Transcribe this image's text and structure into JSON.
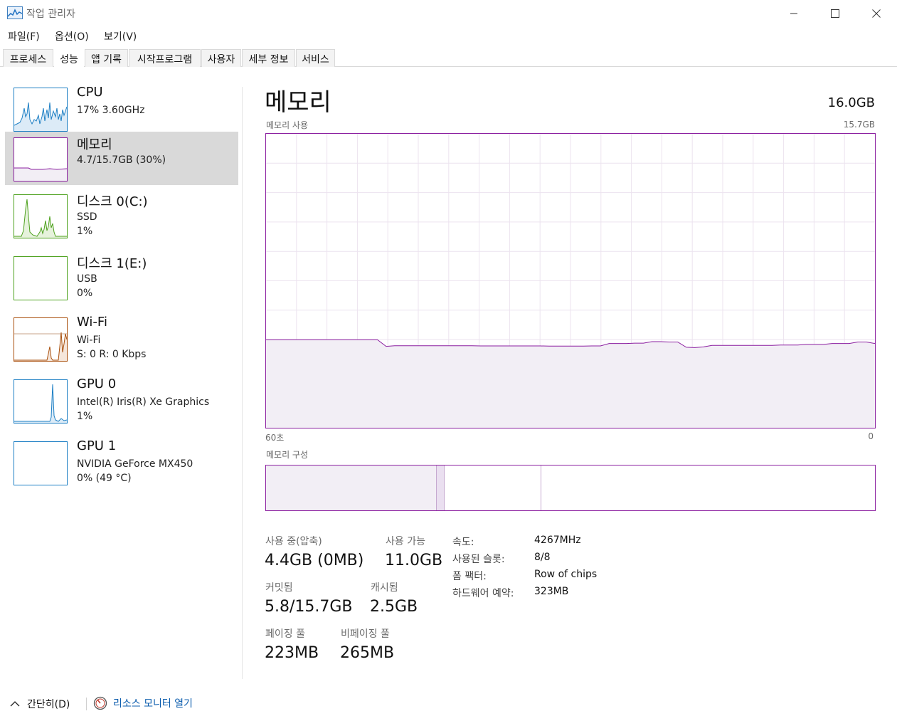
{
  "window": {
    "title": "작업 관리자",
    "icon": "taskmanager-icon"
  },
  "menu": [
    "파일(F)",
    "옵션(O)",
    "보기(V)"
  ],
  "tabs": [
    "프로세스",
    "성능",
    "앱 기록",
    "시작프로그램",
    "사용자",
    "세부 정보",
    "서비스"
  ],
  "active_tab": "성능",
  "sidebar": {
    "items": [
      {
        "name": "CPU",
        "line1": "17%  3.60GHz",
        "line2": "",
        "color": "#1d7fc4"
      },
      {
        "name": "메모리",
        "line1": "4.7/15.7GB (30%)",
        "line2": "",
        "color": "#8b1fa0",
        "selected": true
      },
      {
        "name": "디스크 0(C:)",
        "line1": "SSD",
        "line2": "1%",
        "color": "#4da11d"
      },
      {
        "name": "디스크 1(E:)",
        "line1": "USB",
        "line2": "0%",
        "color": "#4da11d"
      },
      {
        "name": "Wi-Fi",
        "line1": "Wi-Fi",
        "line2": "S: 0  R: 0 Kbps",
        "color": "#a94f0c"
      },
      {
        "name": "GPU 0",
        "line1": "Intel(R) Iris(R) Xe Graphics",
        "line2": "1%",
        "color": "#1d7fc4"
      },
      {
        "name": "GPU 1",
        "line1": "NVIDIA GeForce MX450",
        "line2": "0% (49 °C)",
        "color": "#1d7fc4"
      }
    ]
  },
  "main": {
    "title": "메모리",
    "total": "16.0GB",
    "usage_label": "메모리 사용",
    "usage_max": "15.7GB",
    "axis_left": "60초",
    "axis_right": "0",
    "composition_label": "메모리 구성",
    "accent": "#8b1fa0",
    "stats": {
      "in_use_label": "사용 중(압축)",
      "in_use_value": "4.4GB (0MB)",
      "available_label": "사용 가능",
      "available_value": "11.0GB",
      "committed_label": "커밋됨",
      "committed_value": "5.8/15.7GB",
      "cached_label": "캐시됨",
      "cached_value": "2.5GB",
      "paged_label": "페이징 풀",
      "paged_value": "223MB",
      "nonpaged_label": "비페이징 풀",
      "nonpaged_value": "265MB"
    },
    "details": [
      {
        "label": "속도:",
        "value": "4267MHz"
      },
      {
        "label": "사용된 슬롯:",
        "value": "8/8"
      },
      {
        "label": "폼 팩터:",
        "value": "Row of chips"
      },
      {
        "label": "하드웨어 예약:",
        "value": "323MB"
      }
    ]
  },
  "chart_data": {
    "type": "area",
    "title": "메모리 사용",
    "xlabel": "",
    "ylabel": "",
    "x_range": [
      "60초",
      "0"
    ],
    "ylim": [
      0,
      15.7
    ],
    "grid": true,
    "series": [
      {
        "values": [
          4.7,
          4.7,
          4.7,
          4.7,
          4.7,
          4.7,
          4.7,
          4.7,
          4.7,
          4.7,
          4.7,
          4.7,
          4.7,
          4.7,
          4.35,
          4.38,
          4.38,
          4.38,
          4.38,
          4.38,
          4.38,
          4.38,
          4.38,
          4.38,
          4.38,
          4.37,
          4.37,
          4.37,
          4.37,
          4.37,
          4.37,
          4.37,
          4.37,
          4.36,
          4.36,
          4.36,
          4.36,
          4.36,
          4.37,
          4.37,
          4.5,
          4.5,
          4.5,
          4.52,
          4.52,
          4.6,
          4.6,
          4.58,
          4.58,
          4.3,
          4.28,
          4.32,
          4.4,
          4.4,
          4.4,
          4.4,
          4.4,
          4.4,
          4.4,
          4.4,
          4.42,
          4.42,
          4.42,
          4.45,
          4.45,
          4.45,
          4.5,
          4.5,
          4.5,
          4.58,
          4.58,
          4.5
        ]
      }
    ]
  },
  "composition": {
    "in_use": 4.4,
    "modified": 0.2,
    "standby": 2.5,
    "free": 8.6
  },
  "footer": {
    "collapse": "간단히(D)",
    "monitor": "리소스 모니터 열기"
  }
}
